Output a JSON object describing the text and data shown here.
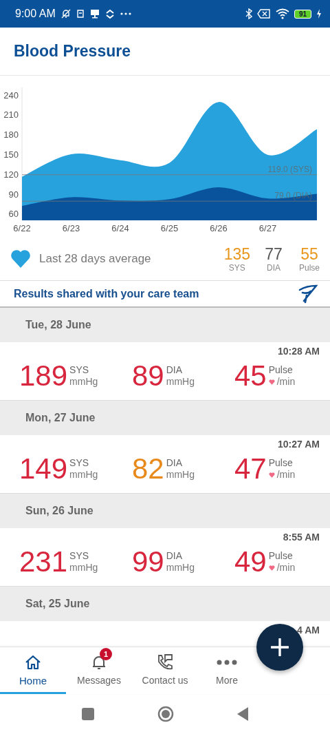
{
  "status_bar": {
    "time": "9:00 AM",
    "battery": "91"
  },
  "header": {
    "title": "Blood Pressure"
  },
  "chart": {
    "chart_data": {
      "type": "area",
      "categories": [
        "6/22",
        "6/23",
        "6/24",
        "6/25",
        "6/26",
        "6/27",
        null
      ],
      "ylim": [
        50,
        250
      ],
      "yticks": [
        60,
        90,
        120,
        150,
        180,
        210,
        240
      ],
      "series": [
        {
          "color": "#27a2dc",
          "values": [
            116,
            150,
            141,
            137,
            229,
            149,
            188
          ]
        },
        {
          "color": "#08539b",
          "values": [
            72,
            85,
            80,
            82,
            100,
            83,
            90
          ]
        }
      ],
      "ref_lines": [
        {
          "axis": "y",
          "value": 119,
          "label": "119.0 (SYS)"
        },
        {
          "axis": "y",
          "value": 79,
          "label": "79.0 (DIA)"
        }
      ]
    }
  },
  "average": {
    "label": "Last 28 days average",
    "values": [
      {
        "value": "135",
        "label": "SYS",
        "color": "#e8961c"
      },
      {
        "value": "77",
        "label": "DIA",
        "color": "#555555"
      },
      {
        "value": "55",
        "label": "Pulse",
        "color": "#e8961c"
      }
    ]
  },
  "shared_banner": {
    "text": "Results shared with your care team"
  },
  "days": [
    {
      "date": "Tue, 28 June",
      "time": "10:28 AM",
      "readings": [
        {
          "value": "189",
          "label": "SYS",
          "unit": "mmHg",
          "color": "#d7263d",
          "kind": "pressure"
        },
        {
          "value": "89",
          "label": "DIA",
          "unit": "mmHg",
          "color": "#d7263d",
          "kind": "pressure"
        },
        {
          "value": "45",
          "label": "Pulse",
          "unit": "/min",
          "color": "#d7263d",
          "kind": "pulse"
        }
      ]
    },
    {
      "date": "Mon, 27 June",
      "time": "10:27 AM",
      "readings": [
        {
          "value": "149",
          "label": "SYS",
          "unit": "mmHg",
          "color": "#d7263d",
          "kind": "pressure"
        },
        {
          "value": "82",
          "label": "DIA",
          "unit": "mmHg",
          "color": "#e8891c",
          "kind": "pressure"
        },
        {
          "value": "47",
          "label": "Pulse",
          "unit": "/min",
          "color": "#d7263d",
          "kind": "pulse"
        }
      ]
    },
    {
      "date": "Sun, 26 June",
      "time": "8:55 AM",
      "readings": [
        {
          "value": "231",
          "label": "SYS",
          "unit": "mmHg",
          "color": "#d7263d",
          "kind": "pressure"
        },
        {
          "value": "99",
          "label": "DIA",
          "unit": "mmHg",
          "color": "#d7263d",
          "kind": "pressure"
        },
        {
          "value": "49",
          "label": "Pulse",
          "unit": "/min",
          "color": "#d7263d",
          "kind": "pulse"
        }
      ]
    },
    {
      "date": "Sat, 25 June",
      "time": "4 AM"
    }
  ],
  "tabs": [
    {
      "label": "Home",
      "selected": true,
      "kind": "home"
    },
    {
      "label": "Messages",
      "selected": false,
      "kind": "bell",
      "badge": "1"
    },
    {
      "label": "Contact us",
      "selected": false,
      "kind": "contact"
    },
    {
      "label": "More",
      "selected": false,
      "kind": "more"
    }
  ]
}
